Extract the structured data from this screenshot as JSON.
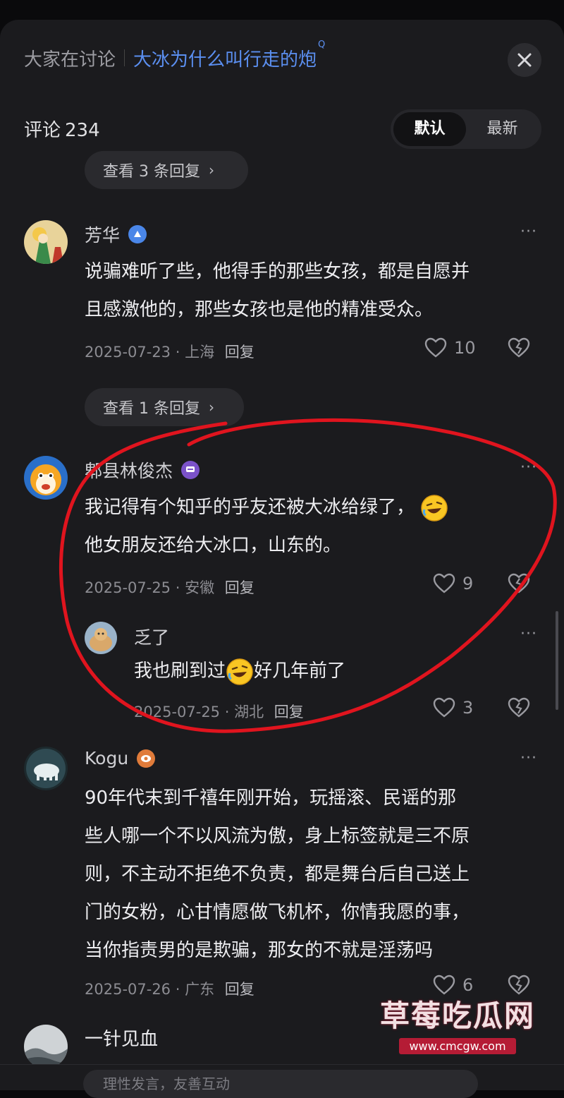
{
  "header": {
    "label": "大家在讨论",
    "topic": "大冰为什么叫行走的炮",
    "topic_search_glyph": "Q"
  },
  "comments_count": {
    "label": "评论",
    "value": "234"
  },
  "sort": {
    "default": "默认",
    "latest": "最新"
  },
  "reply_pill_1": {
    "label": "查看 3 条回复",
    "chevron": "›"
  },
  "reply_pill_2": {
    "label": "查看 1 条回复",
    "chevron": "›"
  },
  "comments": [
    {
      "name": "芳华",
      "badge_color": "#4a86e8",
      "lines": [
        "说骗难听了些，他得手的那些女孩，都是自愿并",
        "且感激他的，那些女孩也是他的精准受众。"
      ],
      "date": "2025-07-23",
      "location": "上海",
      "reply": "回复",
      "likes": "10"
    },
    {
      "name": "郫县林俊杰",
      "badge_color": "#7b52c9",
      "lines": [
        "我记得有个知乎的乎友还被大冰给绿了，",
        "他女朋友还给大冰口，山东的。"
      ],
      "date": "2025-07-25",
      "location": "安徽",
      "reply": "回复",
      "likes": "9"
    },
    {
      "name": "乏了",
      "lines_a": "我也刷到过",
      "lines_b": "好几年前了",
      "date": "2025-07-25",
      "location": "湖北",
      "reply": "回复",
      "likes": "3"
    },
    {
      "name": "Kogu",
      "badge_color": "#e07b3a",
      "lines": [
        "90年代末到千禧年刚开始，玩摇滚、民谣的那",
        "些人哪一个不以风流为傲，身上标签就是三不原",
        "则，不主动不拒绝不负责，都是舞台后自己送上",
        "门的女粉，心甘情愿做飞机杯，你情我愿的事，",
        "当你指责男的是欺骗，那女的不就是淫荡吗"
      ],
      "date": "2025-07-26",
      "location": "广东",
      "reply": "回复",
      "likes": "6"
    },
    {
      "lines": [
        "一针见血"
      ]
    }
  ],
  "bottom_input_text": "理性发言，友善互动",
  "watermark": {
    "title": "草莓吃瓜网",
    "url": "www.cmcgw.com"
  },
  "meta_sep": "·",
  "more_glyph": "···",
  "colors": {
    "accent": "#5b8ff0",
    "annotation": "#e0141e",
    "panel": "#1b1b1e"
  }
}
